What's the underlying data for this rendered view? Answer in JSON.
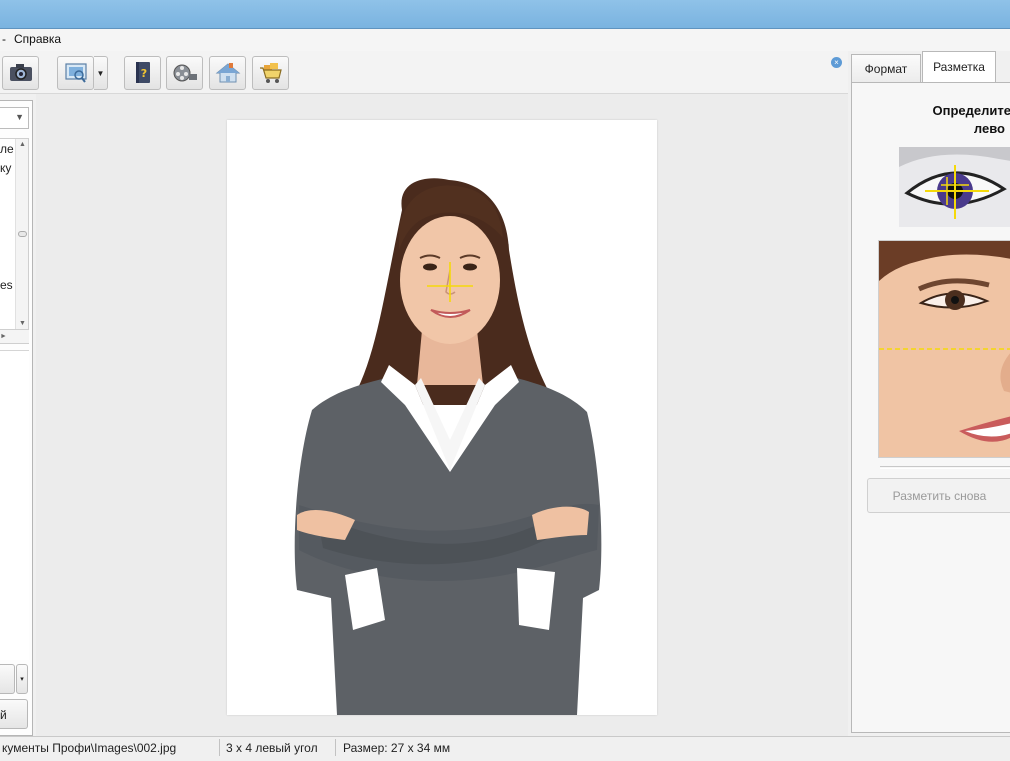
{
  "menu": {
    "help_label": "Справка"
  },
  "toolbar": {
    "icons": [
      "camera-icon",
      "image-preview-icon",
      "help-book-icon",
      "film-reel-icon",
      "house-icon",
      "shopping-cart-icon"
    ],
    "close_glyph": "×"
  },
  "left_panel": {
    "combo_arrow": "▼",
    "list_fragments": [
      "ле",
      "ку",
      "es"
    ],
    "dropdown_arrow": "▾",
    "bottom_button_fragment": "й"
  },
  "right_panel": {
    "tabs": [
      {
        "label": "Формат",
        "active": false
      },
      {
        "label": "Разметка",
        "active": true
      }
    ],
    "heading_line1": "Определите",
    "heading_line2": "лево",
    "remark_button_label": "Разметить снова"
  },
  "status_bar": {
    "path": "кументы Профи\\Images\\002.jpg",
    "format": "3 x 4 левый угол",
    "size": "Размер: 27 х 34 мм"
  },
  "colors": {
    "titlebar": "#7ab3e0",
    "marker_yellow": "#f5d90a",
    "sweater": "#5d6166"
  }
}
